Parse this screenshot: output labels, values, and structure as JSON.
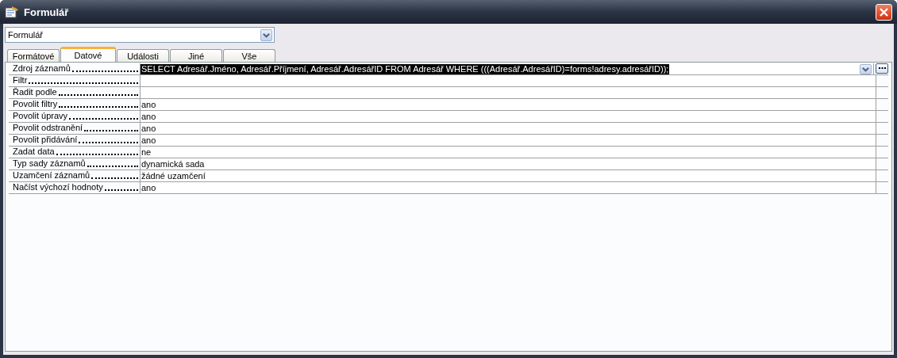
{
  "window": {
    "title": "Formulář"
  },
  "object_selector": {
    "value": "Formulář"
  },
  "tabs": [
    {
      "label": "Formátové",
      "selected": false
    },
    {
      "label": "Datové",
      "selected": true
    },
    {
      "label": "Události",
      "selected": false
    },
    {
      "label": "Jiné",
      "selected": false
    },
    {
      "label": "Vše",
      "selected": false
    }
  ],
  "properties": [
    {
      "name": "Zdroj záznamů",
      "value": "SELECT Adresář.Jméno, Adresář.Příjmení, Adresář.AdresářID FROM Adresář WHERE (((Adresář.AdresářID)=forms!adresy.adresářID));",
      "selected": true
    },
    {
      "name": "Filtr",
      "selected": false
    },
    {
      "name": "Řadit podle",
      "selected": false
    },
    {
      "name": "Povolit filtry",
      "value": "ano",
      "selected": false
    },
    {
      "name": "Povolit úpravy",
      "value": "ano",
      "selected": false
    },
    {
      "name": "Povolit odstranění",
      "value": "ano",
      "selected": false
    },
    {
      "name": "Povolit přidávání",
      "value": "ano",
      "selected": false
    },
    {
      "name": "Zadat data",
      "value": "ne",
      "selected": false
    },
    {
      "name": "Typ sady záznamů",
      "value": "dynamická sada",
      "selected": false
    },
    {
      "name": "Uzamčení záznamů",
      "value": "žádné uzamčení",
      "selected": false
    },
    {
      "name": "Načíst výchozí hodnoty",
      "value": "ano",
      "selected": false
    }
  ]
}
